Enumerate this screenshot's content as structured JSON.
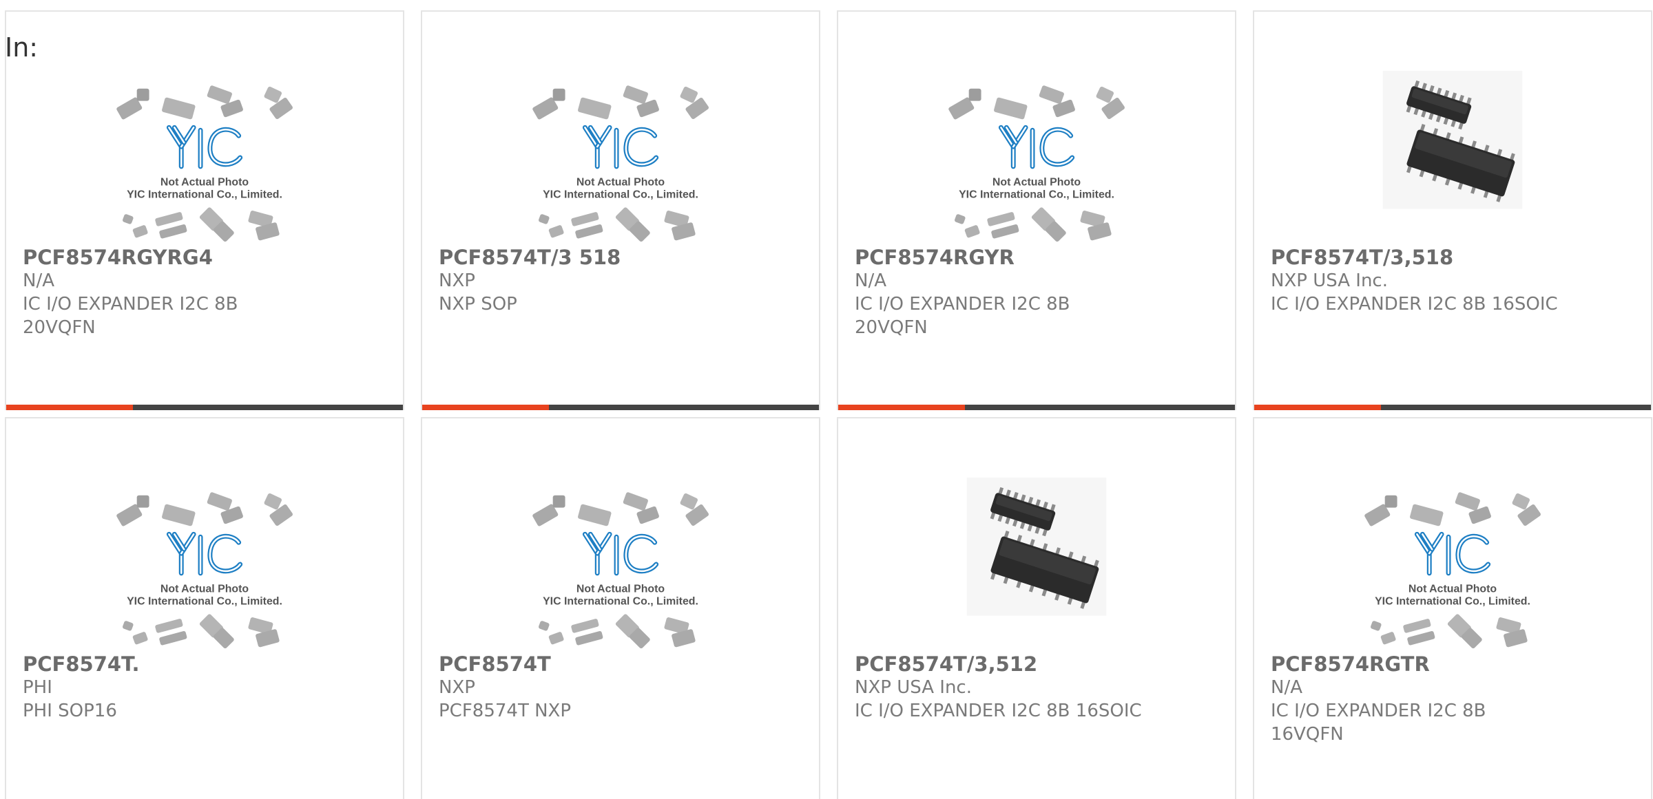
{
  "filter_label": "In:",
  "photo_text": {
    "line1": "Not Actual Photo",
    "line2": "YIC International Co., Limited."
  },
  "colors": {
    "accent": "#e8431f",
    "bar": "#444444",
    "logo_blue": "#1e7fc4"
  },
  "products": [
    {
      "part": "PCF8574RGYRG4",
      "maker": "N/A",
      "desc1": "IC I/O EXPANDER I2C 8B",
      "desc2": "20VQFN",
      "image": "placeholder-photo",
      "bar": true
    },
    {
      "part": "PCF8574T/3 518",
      "maker": "NXP",
      "desc1": "NXP SOP",
      "desc2": "",
      "image": "placeholder-photo",
      "bar": true
    },
    {
      "part": "PCF8574RGYR",
      "maker": "N/A",
      "desc1": "IC I/O EXPANDER I2C 8B",
      "desc2": "20VQFN",
      "image": "placeholder-photo",
      "bar": true
    },
    {
      "part": "PCF8574T/3,518",
      "maker": "NXP USA Inc.",
      "desc1": "IC I/O EXPANDER I2C 8B 16SOIC",
      "desc2": "",
      "image": "soic-chip-photo",
      "bar": true
    },
    {
      "part": "PCF8574T.",
      "maker": "PHI",
      "desc1": "PHI SOP16",
      "desc2": "",
      "image": "placeholder-photo",
      "bar": false
    },
    {
      "part": "PCF8574T",
      "maker": "NXP",
      "desc1": "PCF8574T NXP",
      "desc2": "",
      "image": "placeholder-photo",
      "bar": false
    },
    {
      "part": "PCF8574T/3,512",
      "maker": "NXP USA Inc.",
      "desc1": "IC I/O EXPANDER I2C 8B 16SOIC",
      "desc2": "",
      "image": "soic-chip-photo",
      "bar": false
    },
    {
      "part": "PCF8574RGTR",
      "maker": "N/A",
      "desc1": "IC I/O EXPANDER I2C 8B",
      "desc2": "16VQFN",
      "image": "placeholder-photo",
      "bar": false
    }
  ]
}
